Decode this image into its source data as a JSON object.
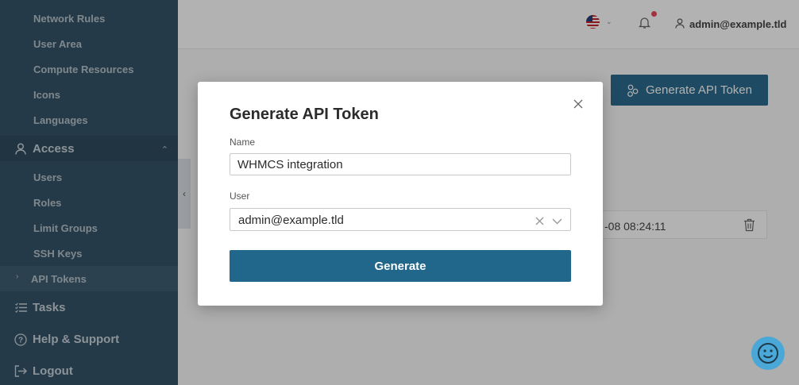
{
  "sidebar": {
    "items_top": [
      {
        "label": "Network Rules"
      },
      {
        "label": "User Area"
      },
      {
        "label": "Compute Resources"
      },
      {
        "label": "Icons"
      },
      {
        "label": "Languages"
      }
    ],
    "access": {
      "label": "Access",
      "icon": "user-icon"
    },
    "access_items": [
      {
        "label": "Users"
      },
      {
        "label": "Roles"
      },
      {
        "label": "Limit Groups"
      },
      {
        "label": "SSH Keys"
      },
      {
        "label": "API Tokens",
        "active": true
      }
    ],
    "tasks": {
      "label": "Tasks",
      "icon": "list-icon"
    },
    "help": {
      "label": "Help & Support",
      "icon": "question-icon"
    },
    "logout": {
      "label": "Logout",
      "icon": "logout-icon"
    }
  },
  "header": {
    "language": "US flag",
    "user": "admin@example.tld"
  },
  "page": {
    "generate_button": "Generate API Token",
    "token_row_date": "-08 08:24:11"
  },
  "modal": {
    "title": "Generate API Token",
    "name_label": "Name",
    "name_value": "WHMCS integration",
    "user_label": "User",
    "user_value": "admin@example.tld",
    "submit_label": "Generate"
  },
  "colors": {
    "sidebar": "#345467",
    "primary": "#21668b",
    "chat": "#4aa8d8"
  }
}
